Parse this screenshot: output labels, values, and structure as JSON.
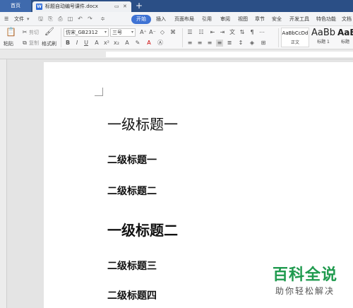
{
  "tabs": {
    "home": "首页",
    "document": "标题自动编号课件.docx",
    "new_tab": "+"
  },
  "menu": {
    "file": "文件",
    "items": [
      "开始",
      "插入",
      "页面布局",
      "引用",
      "审阅",
      "视图",
      "章节",
      "安全",
      "开发工具",
      "特色功能",
      "文档"
    ]
  },
  "ribbon": {
    "paste": "粘贴",
    "cut": "剪切",
    "copy": "复制",
    "format_painter": "格式刷",
    "font_name": "仿宋_GB2312",
    "font_size": "三号",
    "styles": [
      {
        "sample": "AaBbCcDd",
        "name": "正文"
      },
      {
        "sample": "AaBb",
        "name": "标题 1"
      },
      {
        "sample": "AaB",
        "name": "标题"
      }
    ]
  },
  "document": {
    "headings": [
      {
        "level": "一级",
        "text": "一级标题一"
      },
      {
        "level": "二级",
        "text": "二级标题一"
      },
      {
        "level": "二级",
        "text": "二级标题二"
      },
      {
        "level": "一级",
        "text": "一级标题二"
      },
      {
        "level": "二级",
        "text": "二级标题三"
      },
      {
        "level": "二级",
        "text": "二级标题四"
      }
    ]
  },
  "watermark": {
    "title": "百科全说",
    "subtitle": "助你轻松解决"
  },
  "colors": {
    "tab_bar": "#2b4f86",
    "accent": "#3f73d4",
    "watermark_green": "#1f9a4e"
  }
}
